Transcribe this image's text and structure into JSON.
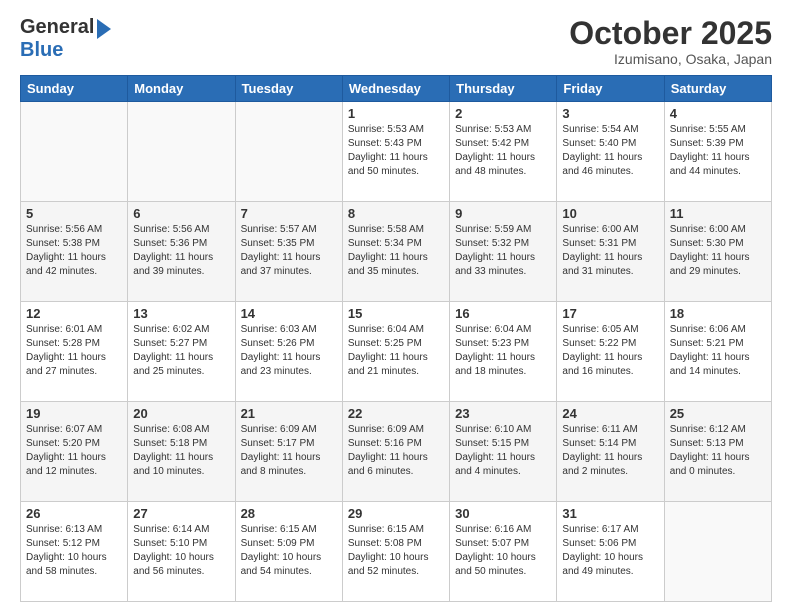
{
  "header": {
    "logo_general": "General",
    "logo_blue": "Blue",
    "month_title": "October 2025",
    "location": "Izumisano, Osaka, Japan"
  },
  "days_of_week": [
    "Sunday",
    "Monday",
    "Tuesday",
    "Wednesday",
    "Thursday",
    "Friday",
    "Saturday"
  ],
  "weeks": [
    {
      "days": [
        {
          "num": "",
          "info": ""
        },
        {
          "num": "",
          "info": ""
        },
        {
          "num": "",
          "info": ""
        },
        {
          "num": "1",
          "info": "Sunrise: 5:53 AM\nSunset: 5:43 PM\nDaylight: 11 hours\nand 50 minutes."
        },
        {
          "num": "2",
          "info": "Sunrise: 5:53 AM\nSunset: 5:42 PM\nDaylight: 11 hours\nand 48 minutes."
        },
        {
          "num": "3",
          "info": "Sunrise: 5:54 AM\nSunset: 5:40 PM\nDaylight: 11 hours\nand 46 minutes."
        },
        {
          "num": "4",
          "info": "Sunrise: 5:55 AM\nSunset: 5:39 PM\nDaylight: 11 hours\nand 44 minutes."
        }
      ]
    },
    {
      "days": [
        {
          "num": "5",
          "info": "Sunrise: 5:56 AM\nSunset: 5:38 PM\nDaylight: 11 hours\nand 42 minutes."
        },
        {
          "num": "6",
          "info": "Sunrise: 5:56 AM\nSunset: 5:36 PM\nDaylight: 11 hours\nand 39 minutes."
        },
        {
          "num": "7",
          "info": "Sunrise: 5:57 AM\nSunset: 5:35 PM\nDaylight: 11 hours\nand 37 minutes."
        },
        {
          "num": "8",
          "info": "Sunrise: 5:58 AM\nSunset: 5:34 PM\nDaylight: 11 hours\nand 35 minutes."
        },
        {
          "num": "9",
          "info": "Sunrise: 5:59 AM\nSunset: 5:32 PM\nDaylight: 11 hours\nand 33 minutes."
        },
        {
          "num": "10",
          "info": "Sunrise: 6:00 AM\nSunset: 5:31 PM\nDaylight: 11 hours\nand 31 minutes."
        },
        {
          "num": "11",
          "info": "Sunrise: 6:00 AM\nSunset: 5:30 PM\nDaylight: 11 hours\nand 29 minutes."
        }
      ]
    },
    {
      "days": [
        {
          "num": "12",
          "info": "Sunrise: 6:01 AM\nSunset: 5:28 PM\nDaylight: 11 hours\nand 27 minutes."
        },
        {
          "num": "13",
          "info": "Sunrise: 6:02 AM\nSunset: 5:27 PM\nDaylight: 11 hours\nand 25 minutes."
        },
        {
          "num": "14",
          "info": "Sunrise: 6:03 AM\nSunset: 5:26 PM\nDaylight: 11 hours\nand 23 minutes."
        },
        {
          "num": "15",
          "info": "Sunrise: 6:04 AM\nSunset: 5:25 PM\nDaylight: 11 hours\nand 21 minutes."
        },
        {
          "num": "16",
          "info": "Sunrise: 6:04 AM\nSunset: 5:23 PM\nDaylight: 11 hours\nand 18 minutes."
        },
        {
          "num": "17",
          "info": "Sunrise: 6:05 AM\nSunset: 5:22 PM\nDaylight: 11 hours\nand 16 minutes."
        },
        {
          "num": "18",
          "info": "Sunrise: 6:06 AM\nSunset: 5:21 PM\nDaylight: 11 hours\nand 14 minutes."
        }
      ]
    },
    {
      "days": [
        {
          "num": "19",
          "info": "Sunrise: 6:07 AM\nSunset: 5:20 PM\nDaylight: 11 hours\nand 12 minutes."
        },
        {
          "num": "20",
          "info": "Sunrise: 6:08 AM\nSunset: 5:18 PM\nDaylight: 11 hours\nand 10 minutes."
        },
        {
          "num": "21",
          "info": "Sunrise: 6:09 AM\nSunset: 5:17 PM\nDaylight: 11 hours\nand 8 minutes."
        },
        {
          "num": "22",
          "info": "Sunrise: 6:09 AM\nSunset: 5:16 PM\nDaylight: 11 hours\nand 6 minutes."
        },
        {
          "num": "23",
          "info": "Sunrise: 6:10 AM\nSunset: 5:15 PM\nDaylight: 11 hours\nand 4 minutes."
        },
        {
          "num": "24",
          "info": "Sunrise: 6:11 AM\nSunset: 5:14 PM\nDaylight: 11 hours\nand 2 minutes."
        },
        {
          "num": "25",
          "info": "Sunrise: 6:12 AM\nSunset: 5:13 PM\nDaylight: 11 hours\nand 0 minutes."
        }
      ]
    },
    {
      "days": [
        {
          "num": "26",
          "info": "Sunrise: 6:13 AM\nSunset: 5:12 PM\nDaylight: 10 hours\nand 58 minutes."
        },
        {
          "num": "27",
          "info": "Sunrise: 6:14 AM\nSunset: 5:10 PM\nDaylight: 10 hours\nand 56 minutes."
        },
        {
          "num": "28",
          "info": "Sunrise: 6:15 AM\nSunset: 5:09 PM\nDaylight: 10 hours\nand 54 minutes."
        },
        {
          "num": "29",
          "info": "Sunrise: 6:15 AM\nSunset: 5:08 PM\nDaylight: 10 hours\nand 52 minutes."
        },
        {
          "num": "30",
          "info": "Sunrise: 6:16 AM\nSunset: 5:07 PM\nDaylight: 10 hours\nand 50 minutes."
        },
        {
          "num": "31",
          "info": "Sunrise: 6:17 AM\nSunset: 5:06 PM\nDaylight: 10 hours\nand 49 minutes."
        },
        {
          "num": "",
          "info": ""
        }
      ]
    }
  ]
}
